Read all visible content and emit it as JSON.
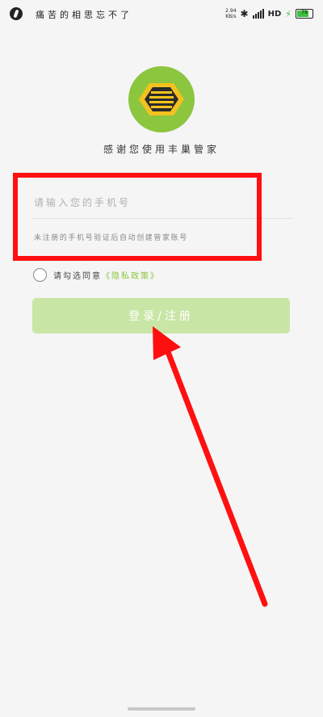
{
  "status_bar": {
    "notification_text": "痛苦的相思忘不了",
    "speed_top": "2.94",
    "speed_bottom": "KB/s",
    "network_label": "HD",
    "battery_value": "79",
    "battery_level_percent": 79
  },
  "app": {
    "tagline": "感谢您使用丰巢管家"
  },
  "login": {
    "phone_placeholder": "请输入您的手机号",
    "phone_value": "",
    "hint": "未注册的手机号验证后自动创建管家账号",
    "agree_prefix": "请勾选同意",
    "privacy_link": "《隐私政策》",
    "submit_label": "登录/注册"
  },
  "colors": {
    "brand_green": "#8cc63f",
    "button_disabled": "#c9e6a6",
    "annotation_red": "#ff1010",
    "logo_yellow": "#f3c21e"
  },
  "icons": {
    "app_logo": "hexagon-hive-icon",
    "bluetooth": "bluetooth-icon",
    "signal": "signal-icon",
    "charging": "bolt-icon"
  }
}
